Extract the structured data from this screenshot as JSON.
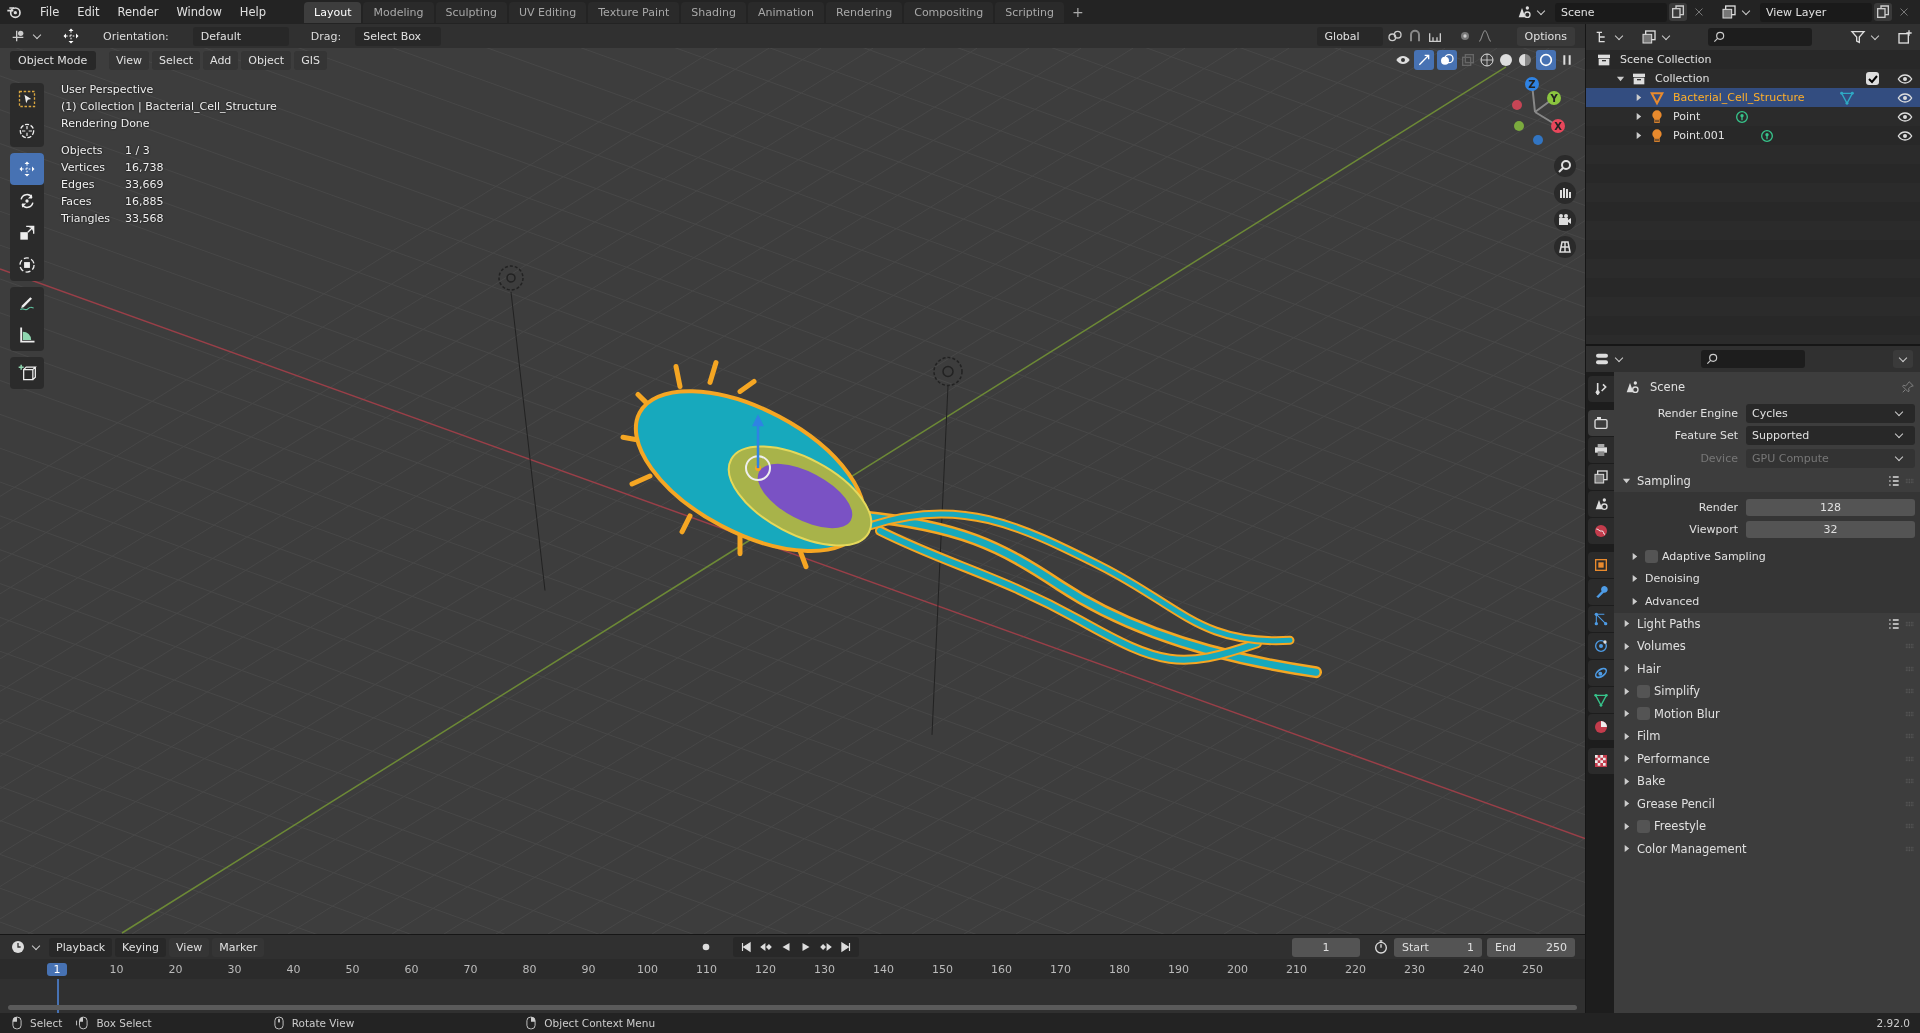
{
  "app_menu": [
    "File",
    "Edit",
    "Render",
    "Window",
    "Help"
  ],
  "workspaces": [
    {
      "label": "Layout",
      "selected": true
    },
    {
      "label": "Modeling",
      "selected": false
    },
    {
      "label": "Sculpting",
      "selected": false
    },
    {
      "label": "UV Editing",
      "selected": false
    },
    {
      "label": "Texture Paint",
      "selected": false
    },
    {
      "label": "Shading",
      "selected": false
    },
    {
      "label": "Animation",
      "selected": false
    },
    {
      "label": "Rendering",
      "selected": false
    },
    {
      "label": "Compositing",
      "selected": false
    },
    {
      "label": "Scripting",
      "selected": false
    }
  ],
  "add_workspace": "+",
  "scene_selector": {
    "value": "Scene"
  },
  "view_layer_selector": {
    "value": "View Layer"
  },
  "tool_settings": {
    "orientation_label": "Orientation:",
    "orientation": "Default",
    "drag_label": "Drag:",
    "drag": "Select Box",
    "transform_orientation": "Global",
    "options": "Options"
  },
  "viewport": {
    "mode": "Object Mode",
    "menus": [
      "View",
      "Select",
      "Add",
      "Object",
      "GIS"
    ],
    "overlay_lines": [
      "User Perspective",
      "(1) Collection | Bacterial_Cell_Structure",
      "Rendering Done"
    ],
    "stats": [
      {
        "label": "Objects",
        "value": "1 / 3"
      },
      {
        "label": "Vertices",
        "value": "16,738"
      },
      {
        "label": "Edges",
        "value": "33,669"
      },
      {
        "label": "Faces",
        "value": "16,885"
      },
      {
        "label": "Triangles",
        "value": "33,568"
      }
    ],
    "gizmo_axes": [
      {
        "label": "Z",
        "color": "#2f83e3"
      },
      {
        "label": "Y",
        "color": "#8bc53f"
      },
      {
        "label": "X",
        "color": "#e8475b"
      }
    ],
    "tool_groups": [
      {
        "tools": [
          {
            "kind": "select",
            "selected": false
          },
          {
            "kind": "cursor",
            "selected": false
          }
        ]
      },
      {
        "tools": [
          {
            "kind": "move",
            "selected": true
          },
          {
            "kind": "rotate",
            "selected": false
          },
          {
            "kind": "scale",
            "selected": false
          },
          {
            "kind": "transform",
            "selected": false
          }
        ]
      },
      {
        "tools": [
          {
            "kind": "annotate",
            "selected": false
          },
          {
            "kind": "measure",
            "selected": false
          }
        ]
      },
      {
        "tools": [
          {
            "kind": "addcube",
            "selected": false
          }
        ]
      }
    ]
  },
  "outliner": {
    "items": [
      {
        "label": "Scene Collection",
        "kind": "scene_collection",
        "selected": false,
        "children": [
          {
            "label": "Collection",
            "kind": "collection",
            "selected": false,
            "expanded": true,
            "checked": true,
            "children": [
              {
                "label": "Bacterial_Cell_Structure",
                "kind": "mesh",
                "selected": true,
                "expanded": false
              },
              {
                "label": "Point",
                "kind": "light",
                "selected": false,
                "expanded": false
              },
              {
                "label": "Point.001",
                "kind": "light",
                "selected": false,
                "expanded": false
              }
            ]
          }
        ]
      }
    ]
  },
  "properties": {
    "tab_groups": [
      {
        "tabs": [
          {
            "kind": "tool",
            "selected": false
          }
        ]
      },
      {
        "tabs": [
          {
            "kind": "render",
            "selected": true
          },
          {
            "kind": "output",
            "selected": false
          },
          {
            "kind": "view_layer",
            "selected": false
          },
          {
            "kind": "scene",
            "selected": false
          },
          {
            "kind": "world",
            "selected": false
          }
        ]
      },
      {
        "tabs": [
          {
            "kind": "object",
            "selected": false
          },
          {
            "kind": "modifiers",
            "selected": false
          },
          {
            "kind": "particles",
            "selected": false
          },
          {
            "kind": "physics",
            "selected": false
          },
          {
            "kind": "constraints",
            "selected": false
          },
          {
            "kind": "data",
            "selected": false
          },
          {
            "kind": "material",
            "selected": false
          }
        ]
      },
      {
        "tabs": [
          {
            "kind": "texture",
            "selected": false
          }
        ]
      }
    ],
    "context": "Scene",
    "fields": [
      {
        "label": "Render Engine",
        "value": "Cycles",
        "disabled": false
      },
      {
        "label": "Feature Set",
        "value": "Supported",
        "disabled": false
      },
      {
        "label": "Device",
        "value": "GPU Compute",
        "disabled": true
      }
    ],
    "panels": [
      {
        "label": "Sampling",
        "kind": "plain",
        "expanded": true,
        "has_presets": true,
        "fields": [
          {
            "label": "Render",
            "value": "128"
          },
          {
            "label": "Viewport",
            "value": "32"
          }
        ],
        "subpanels": [
          {
            "label": "Adaptive Sampling",
            "kind": "checkbox",
            "checked": false
          },
          {
            "label": "Denoising",
            "kind": "plain"
          },
          {
            "label": "Advanced",
            "kind": "plain"
          }
        ]
      },
      {
        "label": "Light Paths",
        "kind": "plain",
        "expanded": false,
        "has_presets": true
      },
      {
        "label": "Volumes",
        "kind": "plain",
        "expanded": false,
        "has_presets": false
      },
      {
        "label": "Hair",
        "kind": "plain",
        "expanded": false,
        "has_presets": false
      },
      {
        "label": "Simplify",
        "kind": "checkbox",
        "checked": false,
        "expanded": false,
        "has_presets": false
      },
      {
        "label": "Motion Blur",
        "kind": "checkbox",
        "checked": false,
        "expanded": false,
        "has_presets": false
      },
      {
        "label": "Film",
        "kind": "plain",
        "expanded": false,
        "has_presets": false
      },
      {
        "label": "Performance",
        "kind": "plain",
        "expanded": false,
        "has_presets": false
      },
      {
        "label": "Bake",
        "kind": "plain",
        "expanded": false,
        "has_presets": false
      },
      {
        "label": "Grease Pencil",
        "kind": "plain",
        "expanded": false,
        "has_presets": false
      },
      {
        "label": "Freestyle",
        "kind": "checkbox",
        "checked": false,
        "expanded": false,
        "has_presets": false
      },
      {
        "label": "Color Management",
        "kind": "plain",
        "expanded": false,
        "has_presets": false
      }
    ]
  },
  "timeline": {
    "menus": [
      "Playback",
      "Keying",
      "View",
      "Marker"
    ],
    "current_frame": "1",
    "start_label": "Start",
    "start": "1",
    "end_label": "End",
    "end": "250",
    "ruler": [
      {
        "label": "1",
        "selected": true
      },
      {
        "label": "10",
        "selected": false
      },
      {
        "label": "20",
        "selected": false
      },
      {
        "label": "30",
        "selected": false
      },
      {
        "label": "40",
        "selected": false
      },
      {
        "label": "50",
        "selected": false
      },
      {
        "label": "60",
        "selected": false
      },
      {
        "label": "70",
        "selected": false
      },
      {
        "label": "80",
        "selected": false
      },
      {
        "label": "90",
        "selected": false
      },
      {
        "label": "100",
        "selected": false
      },
      {
        "label": "110",
        "selected": false
      },
      {
        "label": "120",
        "selected": false
      },
      {
        "label": "130",
        "selected": false
      },
      {
        "label": "140",
        "selected": false
      },
      {
        "label": "150",
        "selected": false
      },
      {
        "label": "160",
        "selected": false
      },
      {
        "label": "170",
        "selected": false
      },
      {
        "label": "180",
        "selected": false
      },
      {
        "label": "190",
        "selected": false
      },
      {
        "label": "200",
        "selected": false
      },
      {
        "label": "210",
        "selected": false
      },
      {
        "label": "220",
        "selected": false
      },
      {
        "label": "230",
        "selected": false
      },
      {
        "label": "240",
        "selected": false
      },
      {
        "label": "250",
        "selected": false
      }
    ]
  },
  "status_bar": {
    "hints": [
      {
        "kind": "left-click",
        "label": "Select"
      },
      {
        "kind": "drag",
        "label": "Box Select"
      },
      {
        "kind": "middle-click",
        "label": "Rotate View"
      },
      {
        "kind": "right-click",
        "label": "Object Context Menu"
      }
    ],
    "version": "2.92.0"
  }
}
